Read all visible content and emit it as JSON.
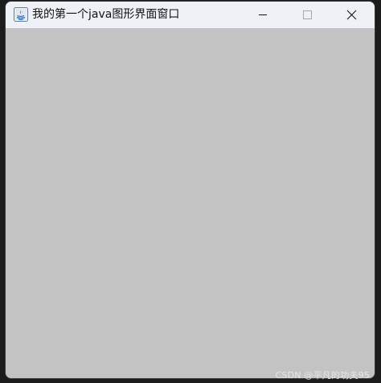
{
  "window": {
    "title": "我的第一个java图形界面窗口",
    "app_icon": "java-icon",
    "controls": {
      "minimize": "minimize-icon",
      "maximize": "maximize-icon",
      "close": "close-icon"
    }
  },
  "watermark": "CSDN @平凡的功夫95",
  "colors": {
    "titlebar": "#eef2f6",
    "content": "#c3c3c3",
    "frame": "#1c1c1c"
  }
}
